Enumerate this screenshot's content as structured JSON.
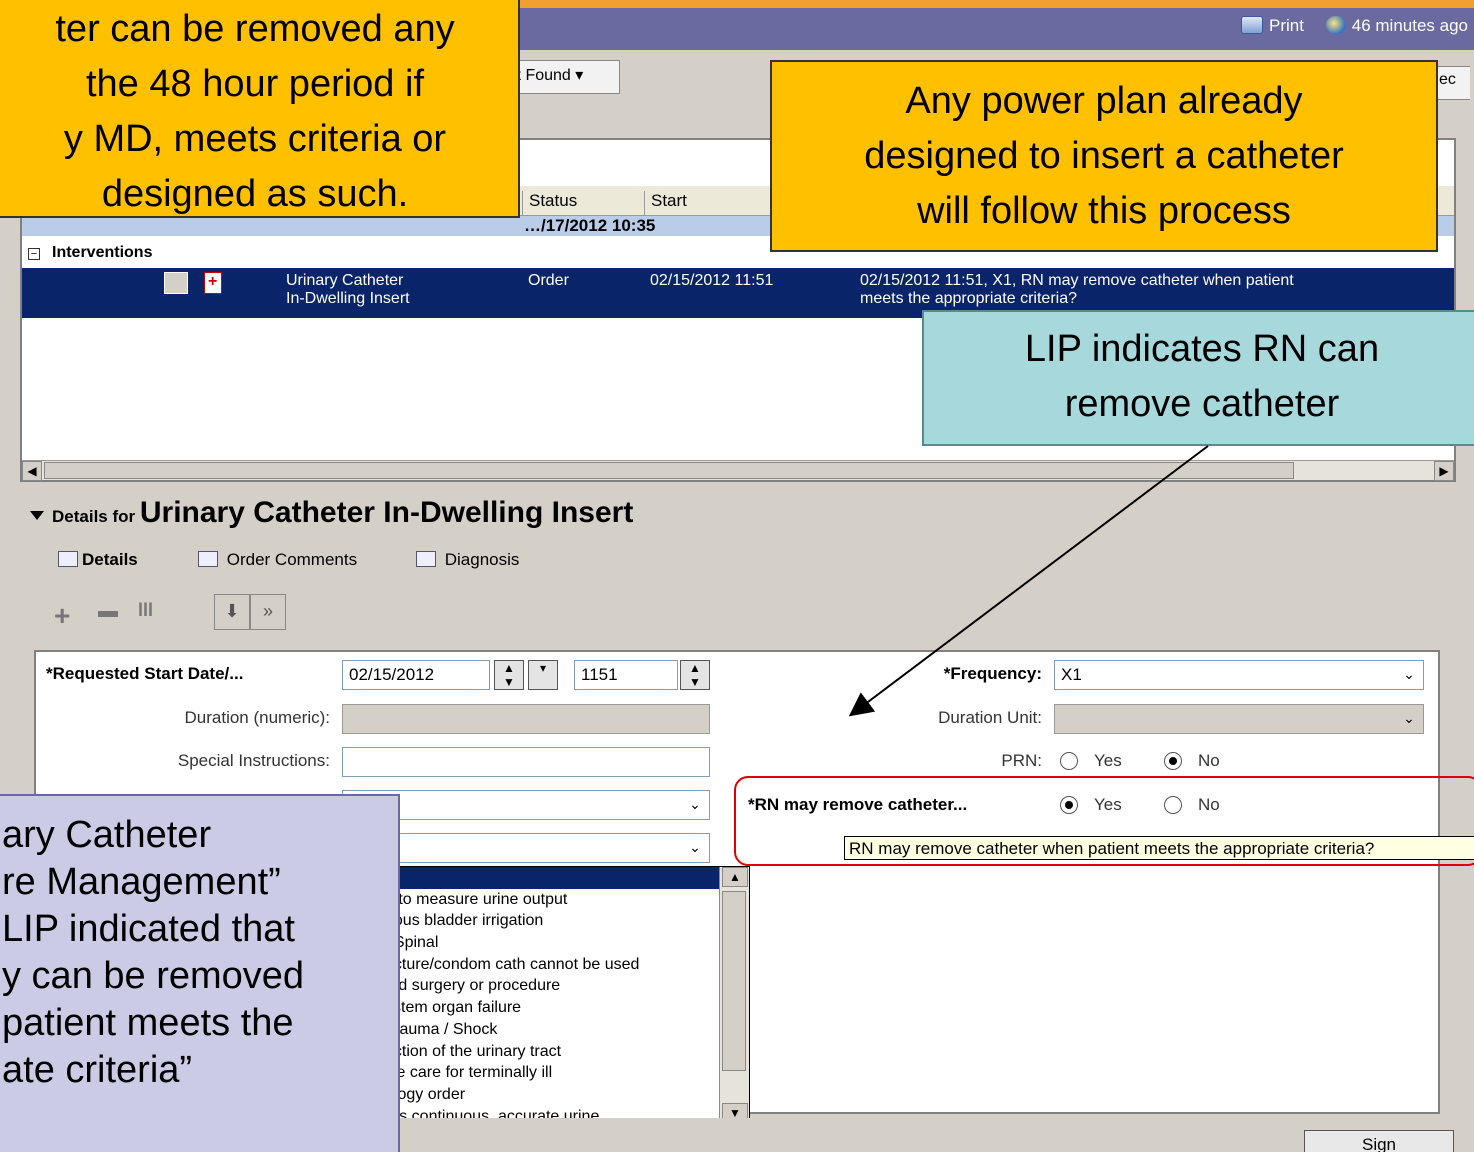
{
  "titlebar": {
    "print_label": "Print",
    "refresh_label": "46 minutes ago"
  },
  "toolbar": {
    "found_label": "it Found",
    "spec_label": "ec"
  },
  "order_table": {
    "headers": {
      "status": "Status",
      "start": "Start"
    },
    "group_row": "…/17/2012 10:35",
    "section": "Interventions",
    "selected_row": {
      "order_line1": "Urinary Catheter",
      "order_line2": "In-Dwelling Insert",
      "status": "Order",
      "start": "02/15/2012 11:51",
      "details_line1": "02/15/2012 11:51, X1, RN may remove catheter when patient",
      "details_line2": "meets the appropriate criteria?"
    }
  },
  "details": {
    "prefix": "Details for",
    "title": "Urinary Catheter In-Dwelling Insert",
    "tabs": {
      "details": "Details",
      "comments": "Order Comments",
      "diagnosis": "Diagnosis"
    }
  },
  "form": {
    "start_date_label": "*Requested Start Date/...",
    "start_date_value": "02/15/2012",
    "start_time_value": "1151",
    "duration_label": "Duration (numeric):",
    "special_label": "Special Instructions:",
    "frequency_label": "*Frequency:",
    "frequency_value": "X1",
    "duration_unit_label": "Duration Unit:",
    "prn_label": "PRN:",
    "prn_yes": "Yes",
    "prn_no": "No",
    "rn_label": "*RN may remove catheter...",
    "rn_yes": "Yes",
    "rn_no": "No",
    "tooltip": "RN may remove catheter when patient meets the appropriate criteria?"
  },
  "dropdown_items": [
    ")",
    "d to measure urine output",
    "uous bladder irrigation",
    "/ Spinal",
    "acture/condom cath cannot be used",
    "ted surgery or procedure",
    "ystem organ failure",
    "Trauma / Shock",
    "uction of the urinary tract",
    "ive care for terminally ill",
    "ology order",
    "res continuous, accurate urine"
  ],
  "sign_label": "Sign",
  "callouts": {
    "top_left": [
      "ter can be removed any",
      "the 48 hour period if",
      "y MD, meets criteria or",
      "designed as such."
    ],
    "top_right": [
      "Any power plan already",
      "designed to insert a catheter",
      "will follow this process"
    ],
    "lip": [
      "LIP indicates RN can",
      "remove catheter"
    ],
    "bottom_left": [
      "ary Catheter",
      "re Management”",
      "LIP indicated that",
      "y can be removed",
      "patient meets the",
      "ate criteria”"
    ]
  }
}
